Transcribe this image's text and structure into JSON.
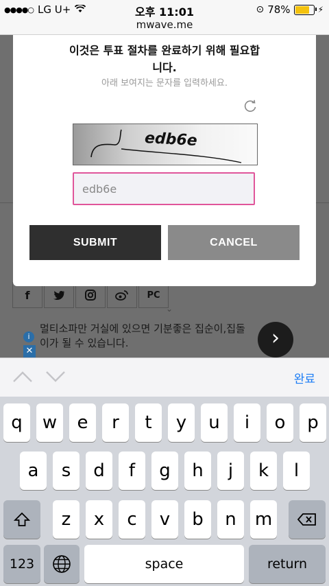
{
  "status": {
    "carrier": "LG U+",
    "time": "오후 11:01",
    "battery": "78%",
    "battery_level": 0.78,
    "url": "mwave.me"
  },
  "background": {
    "social": [
      "f",
      "t",
      "ig",
      "wb",
      "PC"
    ],
    "ad_text": "멀티소파만 거실에 있으면 기분좋은 집순이,집돌이가 될 수 있습니다."
  },
  "modal": {
    "title": "이것은 투표 절차를 완료하기 위해 필요합니다.",
    "subtitle": "아래 보여지는 문자를 입력하세요.",
    "captcha_text": "edb6e",
    "input_value": "edb6e",
    "submit_label": "SUBMIT",
    "cancel_label": "CANCEL"
  },
  "accessory": {
    "done_label": "완료"
  },
  "keyboard": {
    "row1": [
      "q",
      "w",
      "e",
      "r",
      "t",
      "y",
      "u",
      "i",
      "o",
      "p"
    ],
    "row2": [
      "a",
      "s",
      "d",
      "f",
      "g",
      "h",
      "j",
      "k",
      "l"
    ],
    "row3": [
      "z",
      "x",
      "c",
      "v",
      "b",
      "n",
      "m"
    ],
    "numbers_label": "123",
    "space_label": "space",
    "return_label": "return"
  },
  "colors": {
    "input_border": "#e0559a",
    "done_blue": "#1a7cf5",
    "battery_fill": "#f4c20d"
  }
}
